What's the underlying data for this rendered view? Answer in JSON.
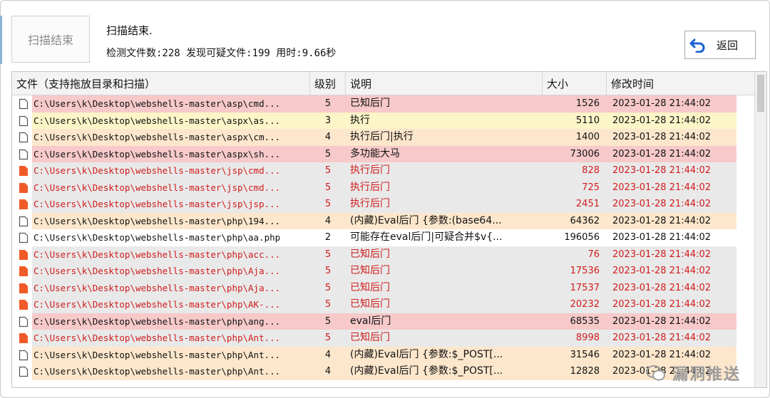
{
  "sidebar": {
    "scan_button_label": "扫描结束"
  },
  "status": {
    "title": "扫描结束.",
    "stats": "检测文件数:228 发现可疑文件:199 用时:9.66秒"
  },
  "toolbar": {
    "back_label": "返回"
  },
  "table": {
    "columns": [
      "文件（支持拖放目录和扫描）",
      "级别",
      "说明",
      "大小",
      "修改时间"
    ],
    "rows": [
      {
        "file": "C:\\Users\\k\\Desktop\\webshells-master\\asp\\cmd...",
        "level": "5",
        "desc": "已知后门",
        "size": "1526",
        "time": "2023-01-28 21:44:02",
        "bg": "#f7c9c9",
        "red": false,
        "icon": "page"
      },
      {
        "file": "C:\\Users\\k\\Desktop\\webshells-master\\aspx\\as...",
        "level": "3",
        "desc": "执行",
        "size": "5110",
        "time": "2023-01-28 21:44:02",
        "bg": "#fbf5c8",
        "red": false,
        "icon": "page"
      },
      {
        "file": "C:\\Users\\k\\Desktop\\webshells-master\\aspx\\cm...",
        "level": "4",
        "desc": "执行后门|执行",
        "size": "1400",
        "time": "2023-01-28 21:44:02",
        "bg": "#fde7cc",
        "red": false,
        "icon": "page"
      },
      {
        "file": "C:\\Users\\k\\Desktop\\webshells-master\\aspx\\sh...",
        "level": "5",
        "desc": "多功能大马",
        "size": "73006",
        "time": "2023-01-28 21:44:02",
        "bg": "#f7c9c9",
        "red": false,
        "icon": "page"
      },
      {
        "file": "C:\\Users\\k\\Desktop\\webshells-master\\jsp\\cmd...",
        "level": "5",
        "desc": "执行后门",
        "size": "828",
        "time": "2023-01-28 21:44:02",
        "bg": "#e9e9e9",
        "red": true,
        "icon": "red"
      },
      {
        "file": "C:\\Users\\k\\Desktop\\webshells-master\\jsp\\cmd...",
        "level": "5",
        "desc": "执行后门",
        "size": "725",
        "time": "2023-01-28 21:44:02",
        "bg": "#e9e9e9",
        "red": true,
        "icon": "red"
      },
      {
        "file": "C:\\Users\\k\\Desktop\\webshells-master\\jsp\\jsp...",
        "level": "5",
        "desc": "执行后门",
        "size": "2451",
        "time": "2023-01-28 21:44:02",
        "bg": "#e9e9e9",
        "red": true,
        "icon": "red"
      },
      {
        "file": "C:\\Users\\k\\Desktop\\webshells-master\\php\\194...",
        "level": "4",
        "desc": "(内藏)Eval后门 {参数:(base64...",
        "size": "64362",
        "time": "2023-01-28 21:44:02",
        "bg": "#fde7cc",
        "red": false,
        "icon": "page"
      },
      {
        "file": "C:\\Users\\k\\Desktop\\webshells-master\\php\\aa.php",
        "level": "2",
        "desc": "可能存在eval后门|可疑合并$v{...",
        "size": "196056",
        "time": "2023-01-28 21:44:02",
        "bg": "#ffffff",
        "red": false,
        "icon": "page"
      },
      {
        "file": "C:\\Users\\k\\Desktop\\webshells-master\\php\\acc...",
        "level": "5",
        "desc": "已知后门",
        "size": "76",
        "time": "2023-01-28 21:44:02",
        "bg": "#e9e9e9",
        "red": true,
        "icon": "red"
      },
      {
        "file": "C:\\Users\\k\\Desktop\\webshells-master\\php\\Aja...",
        "level": "5",
        "desc": "已知后门",
        "size": "17536",
        "time": "2023-01-28 21:44:02",
        "bg": "#e9e9e9",
        "red": true,
        "icon": "red"
      },
      {
        "file": "C:\\Users\\k\\Desktop\\webshells-master\\php\\Aja...",
        "level": "5",
        "desc": "已知后门",
        "size": "17537",
        "time": "2023-01-28 21:44:02",
        "bg": "#e9e9e9",
        "red": true,
        "icon": "red"
      },
      {
        "file": "C:\\Users\\k\\Desktop\\webshells-master\\php\\AK-...",
        "level": "5",
        "desc": "已知后门",
        "size": "20232",
        "time": "2023-01-28 21:44:02",
        "bg": "#e9e9e9",
        "red": true,
        "icon": "red"
      },
      {
        "file": "C:\\Users\\k\\Desktop\\webshells-master\\php\\ang...",
        "level": "5",
        "desc": "eval后门",
        "size": "68535",
        "time": "2023-01-28 21:44:02",
        "bg": "#f7c9c9",
        "red": false,
        "icon": "page"
      },
      {
        "file": "C:\\Users\\k\\Desktop\\webshells-master\\php\\Ant...",
        "level": "5",
        "desc": "已知后门",
        "size": "8998",
        "time": "2023-01-28 21:44:02",
        "bg": "#e9e9e9",
        "red": true,
        "icon": "red"
      },
      {
        "file": "C:\\Users\\k\\Desktop\\webshells-master\\php\\Ant...",
        "level": "4",
        "desc": "(内藏)Eval后门 {参数:$_POST[...",
        "size": "31546",
        "time": "2023-01-28 21:44:02",
        "bg": "#fde7cc",
        "red": false,
        "icon": "page"
      },
      {
        "file": "C:\\Users\\k\\Desktop\\webshells-master\\php\\Ant...",
        "level": "4",
        "desc": "(内藏)Eval后门 {参数:$_POST[...",
        "size": "12828",
        "time": "2023-01-28 21:44:02",
        "bg": "#fde7cc",
        "red": false,
        "icon": "page"
      }
    ]
  },
  "watermark": {
    "text": "漏洞推送"
  },
  "colors": {
    "red_text": "#d01c1c",
    "level5_bg": "#f7c9c9",
    "level4_bg": "#fde7cc",
    "level3_bg": "#fbf5c8",
    "gray_bg": "#e9e9e9"
  }
}
